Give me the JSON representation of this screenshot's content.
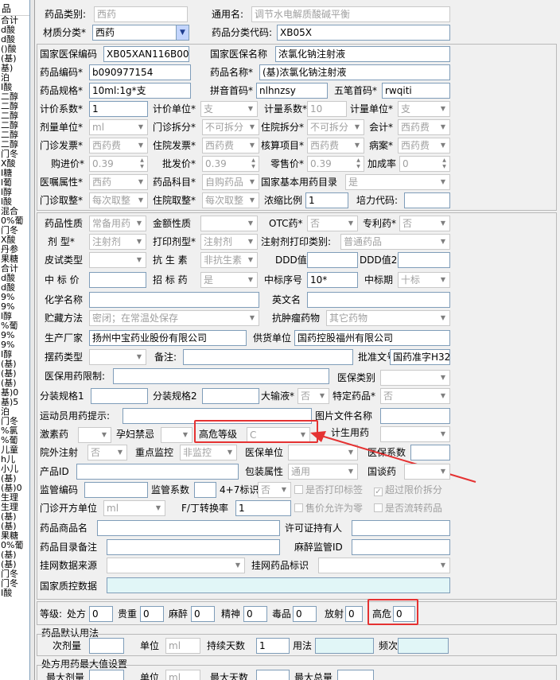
{
  "sidebar": {
    "header": "品",
    "items": [
      "合计",
      "d酸",
      "d酸",
      "()酸",
      "(基)",
      "基)",
      "泊",
      "I酸",
      "二醇",
      "二醇",
      "二醇",
      "二醇",
      "二醇",
      "二醇",
      "门冬",
      "X酸",
      "I糖",
      "l葡",
      "l醇",
      "l酸",
      "混合",
      "0%葡",
      "门冬",
      "X酸",
      "丹参",
      "果糖",
      "合计",
      "d酸",
      "d酸",
      "9%",
      "9%",
      "l醇",
      "%葡",
      "9%",
      "9%",
      "I醇",
      "(基)",
      "(基)",
      "(基)",
      "基)0",
      "基)5",
      "泊",
      "门冬",
      "%氯",
      "%葡",
      "儿童",
      "h儿",
      "小儿",
      "(基)",
      "(基)0",
      "生理",
      "生理",
      "(基)",
      "(基)",
      "果糖",
      "0%葡",
      "(基)",
      "(基)",
      "门冬",
      "门冬",
      "I酸"
    ]
  },
  "fields": {
    "drug_category": {
      "label": "药品类别:",
      "value": "西药"
    },
    "generic_name": {
      "label": "通用名:",
      "value": "调节水电解质酸碱平衡"
    },
    "material_class": {
      "label": "材质分类*",
      "value": "西药"
    },
    "class_code": {
      "label": "药品分类代码:",
      "value": "XB05X"
    },
    "nhsa_code": {
      "label": "国家医保编码",
      "value": "XB05XAN116B0020"
    },
    "nhsa_name": {
      "label": "国家医保名称",
      "value": "浓氯化钠注射液"
    },
    "drug_code": {
      "label": "药品编码*",
      "value": "b090977154"
    },
    "drug_name": {
      "label": "药品名称*",
      "value": "(基)浓氯化钠注射液"
    },
    "spec": {
      "label": "药品规格*",
      "value": "10ml:1g*支"
    },
    "pinyin": {
      "label": "拼音首码*",
      "value": "nlhnzsy"
    },
    "wubi": {
      "label": "五笔首码*",
      "value": "rwqiti"
    },
    "price_coef": {
      "label": "计价系数*",
      "value": "1"
    },
    "price_unit": {
      "label": "计价单位*",
      "value": "支"
    },
    "dose_coef": {
      "label": "计量系数*",
      "value": "10"
    },
    "dose_unit2": {
      "label": "计量单位*",
      "value": "支"
    },
    "dose_unit": {
      "label": "剂量单位*",
      "value": "ml"
    },
    "op_split": {
      "label": "门诊拆分*",
      "value": "不可拆分"
    },
    "ip_split": {
      "label": "住院拆分*",
      "value": "不可拆分"
    },
    "account": {
      "label": "会计*",
      "value": "西药费"
    },
    "op_invoice": {
      "label": "门诊发票*",
      "value": "西药费"
    },
    "ip_invoice": {
      "label": "住院发票*",
      "value": "西药费"
    },
    "audit_item": {
      "label": "核算项目*",
      "value": "西药费"
    },
    "case": {
      "label": "病案*",
      "value": "西药费"
    },
    "purchase_price": {
      "label": "购进价*",
      "value": "0.39"
    },
    "wholesale_price": {
      "label": "批发价*",
      "value": "0.39"
    },
    "retail_price": {
      "label": "零售价*",
      "value": "0.39"
    },
    "markup": {
      "label": "加成率",
      "value": "0"
    },
    "order_attr": {
      "label": "医嘱属性*",
      "value": "西药"
    },
    "drug_subject": {
      "label": "药品科目*",
      "value": "自购药品"
    },
    "basic_catalog": {
      "label": "国家基本用药目录",
      "value": "是"
    },
    "op_take": {
      "label": "门诊取整*",
      "value": "每次取整"
    },
    "ip_take": {
      "label": "住院取整*",
      "value": "每次取整"
    },
    "concentration": {
      "label": "浓缩比例",
      "value": "1"
    },
    "training_code": {
      "label": "培力代码:",
      "value": ""
    },
    "nature": {
      "label": "药品性质",
      "value": "常备用药"
    },
    "amount_nature": {
      "label": "金额性质",
      "value": ""
    },
    "otc": {
      "label": "OTC药*",
      "value": "否"
    },
    "patent": {
      "label": "专利药*",
      "value": "否"
    },
    "dosage_form": {
      "label": "剂  型*",
      "value": "注射剂"
    },
    "print_form": {
      "label": "打印剂型*",
      "value": "注射剂"
    },
    "inj_print_cat": {
      "label": "注射剂打印类别:",
      "value": "普通药品"
    },
    "skin_test": {
      "label": "皮试类型",
      "value": ""
    },
    "antibiotic": {
      "label": "抗 生 素",
      "value": "非抗生素"
    },
    "ddd": {
      "label": "DDD值",
      "value": ""
    },
    "ddd2": {
      "label": "DDD值2",
      "value": ""
    },
    "bid_price": {
      "label": "中 标 价",
      "value": ""
    },
    "bid_drug": {
      "label": "招 标 药",
      "value": "是"
    },
    "bid_no": {
      "label": "中标序号",
      "value": "10*"
    },
    "bid_period": {
      "label": "中标期",
      "value": "十标"
    },
    "chem_name": {
      "label": "化学名称",
      "value": ""
    },
    "en_name": {
      "label": "英文名",
      "value": ""
    },
    "storage": {
      "label": "贮藏方法",
      "value": "密闭；在常温处保存"
    },
    "antitumor": {
      "label": "抗肿瘤药物",
      "value": "其它药物"
    },
    "manufacturer": {
      "label": "生产厂家",
      "value": "扬州中宝药业股份有限公司"
    },
    "supplier": {
      "label": "供货单位",
      "value": "国药控股福州有限公司"
    },
    "placement": {
      "label": "摆药类型",
      "value": ""
    },
    "remark": {
      "label": "备注:",
      "value": ""
    },
    "approval": {
      "label": "批准文号",
      "value": "国药准字H32"
    },
    "insurance_limit": {
      "label": "医保用药限制:",
      "value": ""
    },
    "insurance_cat": {
      "label": "医保类别",
      "value": ""
    },
    "pack_spec1": {
      "label": "分装规格1",
      "value": ""
    },
    "pack_spec2": {
      "label": "分装规格2",
      "value": ""
    },
    "infusion": {
      "label": "大输液*",
      "value": "否"
    },
    "special": {
      "label": "特定药品*",
      "value": "否"
    },
    "athlete": {
      "label": "运动员用药提示:",
      "value": ""
    },
    "image_file": {
      "label": "图片文件名称",
      "value": ""
    },
    "hormone": {
      "label": "激素药",
      "value": ""
    },
    "pregnancy": {
      "label": "孕妇禁忌",
      "value": ""
    },
    "high_risk_level": {
      "label": "高危等级",
      "value": "C"
    },
    "family_plan": {
      "label": "计生用药",
      "value": ""
    },
    "outside_inj": {
      "label": "院外注射",
      "value": "否"
    },
    "key_monitor": {
      "label": "重点监控",
      "value": "非监控"
    },
    "ins_unit": {
      "label": "医保单位",
      "value": ""
    },
    "ins_coef": {
      "label": "医保系数",
      "value": ""
    },
    "product_id": {
      "label": "产品ID",
      "value": ""
    },
    "pack_attr": {
      "label": "包装属性",
      "value": "通用"
    },
    "negotiated": {
      "label": "国谈药",
      "value": ""
    },
    "supervise_code": {
      "label": "监管编码",
      "value": ""
    },
    "supervise_coef": {
      "label": "监管系数",
      "value": ""
    },
    "four_seven": {
      "label": "4+7标识",
      "value": "否"
    },
    "op_unit": {
      "label": "门诊开方单位",
      "value": "ml"
    },
    "fd_rate": {
      "label": "F/丁转换率",
      "value": "1"
    },
    "trade_name": {
      "label": "药品商品名",
      "value": ""
    },
    "license_holder": {
      "label": "许可证持有人",
      "value": ""
    },
    "catalog_note": {
      "label": "药品目录备注",
      "value": ""
    },
    "anesth_id": {
      "label": "麻醉监管ID",
      "value": ""
    },
    "net_source": {
      "label": "挂网数据来源",
      "value": ""
    },
    "net_flag": {
      "label": "挂网药品标识",
      "value": ""
    },
    "quality_data": {
      "label": "国家质控数据",
      "value": ""
    }
  },
  "checks": {
    "print_label": {
      "label": "是否打印标签",
      "checked": false
    },
    "over_limit": {
      "label": "超过限价拆分",
      "checked": true
    },
    "sale_zero": {
      "label": "售价允许为零",
      "checked": false
    },
    "circulate": {
      "label": "是否流转药品",
      "checked": false
    }
  },
  "grades": {
    "label": "等级:",
    "op": {
      "label": "处方",
      "value": "0"
    },
    "precious": {
      "label": "贵重",
      "value": "0"
    },
    "anesthetic": {
      "label": "麻醉",
      "value": "0"
    },
    "psych": {
      "label": "精神",
      "value": "0"
    },
    "toxic": {
      "label": "毒品",
      "value": "0"
    },
    "radio": {
      "label": "放射",
      "value": "0"
    },
    "high_risk": {
      "label": "高危",
      "value": "0"
    }
  },
  "default_usage": {
    "title": "药品默认用法",
    "dose": {
      "label": "次剂量",
      "value": ""
    },
    "unit": {
      "label": "单位",
      "value": "ml"
    },
    "days": {
      "label": "持续天数",
      "value": "1"
    },
    "usage": {
      "label": "用法",
      "value": ""
    },
    "freq": {
      "label": "频次",
      "value": ""
    }
  },
  "max_values": {
    "title": "处方用药最大值设置",
    "max_dose": {
      "label": "最大剂量",
      "value": ""
    },
    "unit": {
      "label": "单位",
      "value": "ml"
    },
    "max_days": {
      "label": "最大天数",
      "value": ""
    },
    "max_total": {
      "label": "最大总量",
      "value": ""
    }
  },
  "colors": {
    "highlight": "#e53232",
    "arrow": "#e53232"
  }
}
